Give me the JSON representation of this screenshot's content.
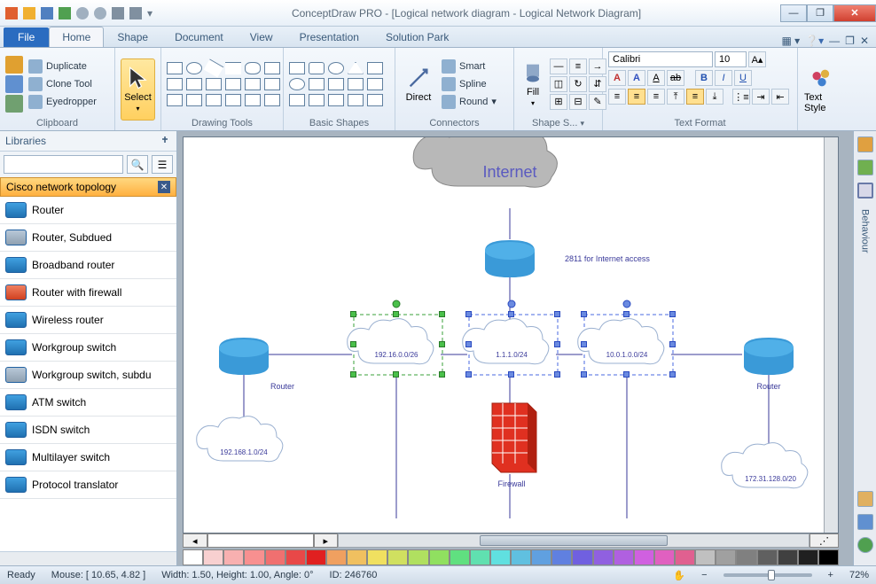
{
  "window": {
    "title": "ConceptDraw PRO - [Logical network diagram - Logical Network Diagram]"
  },
  "tabs": {
    "file": "File",
    "items": [
      "Home",
      "Shape",
      "Document",
      "View",
      "Presentation",
      "Solution Park"
    ],
    "active": "Home"
  },
  "ribbon": {
    "clipboard": {
      "label": "Clipboard",
      "duplicate": "Duplicate",
      "clone": "Clone Tool",
      "eyedropper": "Eyedropper"
    },
    "select": {
      "label": "Select"
    },
    "drawing": {
      "label": "Drawing Tools"
    },
    "basic": {
      "label": "Basic Shapes"
    },
    "connectors": {
      "label": "Connectors",
      "direct": "Direct",
      "smart": "Smart",
      "spline": "Spline",
      "round": "Round"
    },
    "fill": {
      "label": "Fill"
    },
    "shapestyle": {
      "label": "Shape S..."
    },
    "textformat": {
      "label": "Text Format",
      "font": "Calibri",
      "size": "10"
    },
    "textstyle": {
      "label": "Text Style"
    }
  },
  "libraries": {
    "title": "Libraries",
    "search_placeholder": "",
    "category": "Cisco network topology",
    "items": [
      "Router",
      "Router, Subdued",
      "Broadband router",
      "Router with firewall",
      "Wireless router",
      "Workgroup switch",
      "Workgroup switch, subdu",
      "ATM switch",
      "ISDN switch",
      "Multilayer switch",
      "Protocol translator"
    ]
  },
  "canvas": {
    "internet": "Internet",
    "router_note": "2811 for Internet access",
    "net1": "192.16.0.0/26",
    "net2": "1.1.1.0/24",
    "net3": "10.0.1.0.0/24",
    "net4": "192.168.1.0/24",
    "net5": "172.31.128.0/20",
    "router_label_left": "Router",
    "router_label_right": "Router",
    "firewall": "Firewall"
  },
  "right": {
    "behaviour": "Behaviour"
  },
  "status": {
    "ready": "Ready",
    "mouse": "Mouse: [ 10.65, 4.82 ]",
    "dims": "Width: 1.50,  Height: 1.00,  Angle: 0°",
    "id": "ID: 246760",
    "zoom": "72%"
  },
  "palette": [
    "#ffffff",
    "#f8d0d0",
    "#f8b0b0",
    "#f89090",
    "#f07070",
    "#e84848",
    "#e02020",
    "#f0a060",
    "#f0c060",
    "#f0e060",
    "#d0e060",
    "#b0e060",
    "#90e060",
    "#60e080",
    "#60e0b0",
    "#60e0e0",
    "#60c0e0",
    "#60a0e0",
    "#6080e0",
    "#7060e0",
    "#9060e0",
    "#b060e0",
    "#d060e0",
    "#e060c0",
    "#e06090",
    "#c0c0c0",
    "#a0a0a0",
    "#808080",
    "#606060",
    "#404040",
    "#202020",
    "#000000"
  ]
}
